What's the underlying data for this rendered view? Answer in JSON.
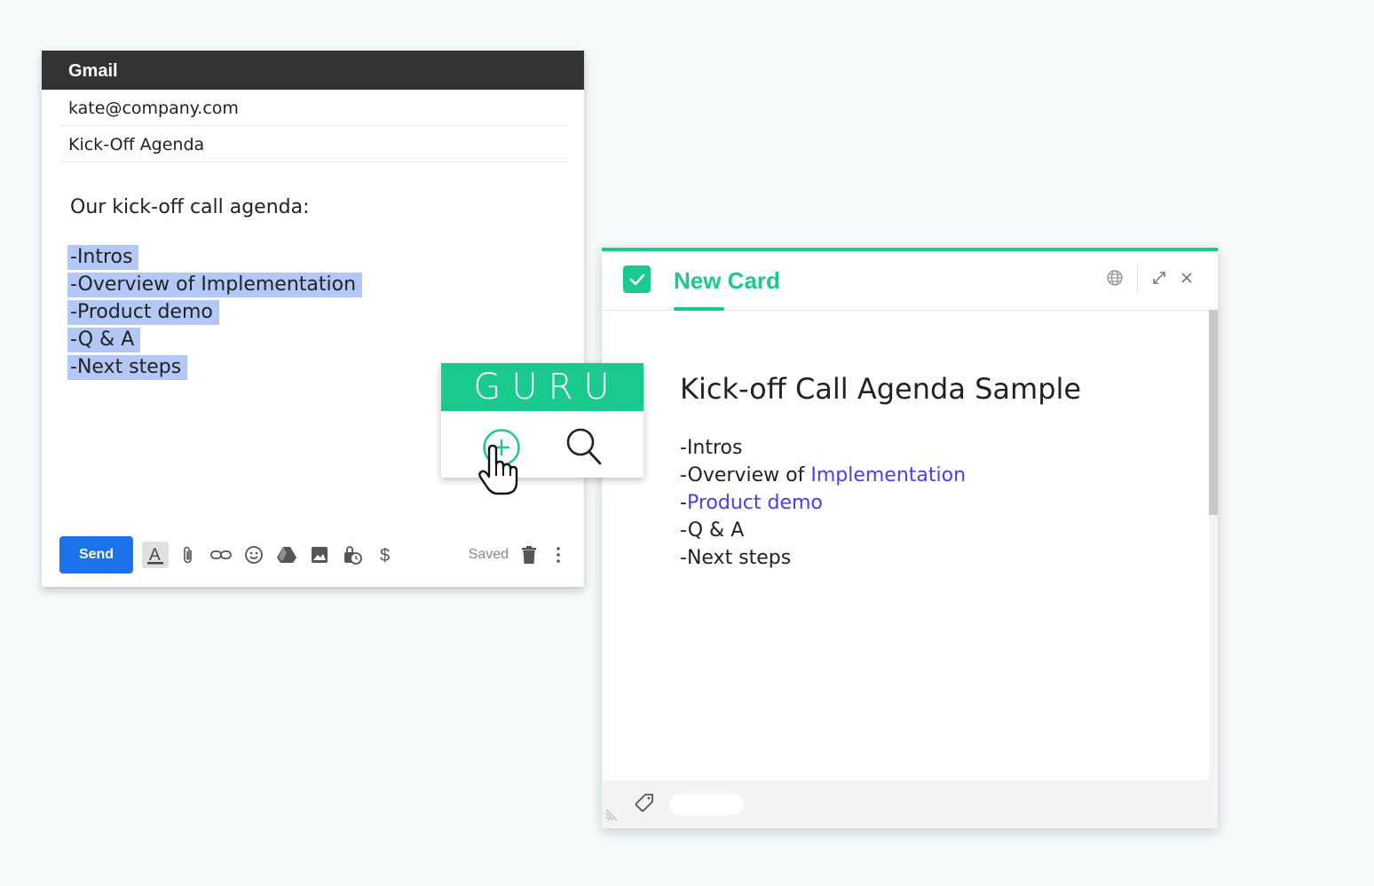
{
  "gmail": {
    "title": "Gmail",
    "to": "kate@company.com",
    "subject": "Kick-Off Agenda",
    "intro": "Our kick-off call agenda:",
    "agenda": [
      "-Intros",
      "-Overview of Implementation",
      "-Product demo",
      "-Q & A",
      "-Next steps"
    ],
    "send_label": "Send",
    "saved_label": "Saved",
    "toolbar_icons": [
      "format-text-icon",
      "attach-icon",
      "link-icon",
      "emoji-icon",
      "drive-icon",
      "image-icon",
      "confidential-icon",
      "money-icon"
    ],
    "accent": "#1a73e8",
    "highlight": "#b3c8f7"
  },
  "guru_popup": {
    "brand": "GURU",
    "brand_color": "#1ac98e",
    "actions": [
      "add-card-icon",
      "search-icon"
    ]
  },
  "card": {
    "title": "New Card",
    "doc_title": "Kick-off Call Agenda Sample",
    "lines": {
      "intros": "-Intros",
      "overview_prefix": "-Overview of ",
      "overview_link": "Implementation",
      "demo_prefix": "-",
      "demo_link": "Product demo",
      "qa": "-Q & A",
      "next": "-Next steps"
    },
    "link_color": "#4a3cf5",
    "header_icons": [
      "globe-icon",
      "expand-icon",
      "close-icon"
    ],
    "footer_icons": [
      "tag-icon"
    ]
  }
}
